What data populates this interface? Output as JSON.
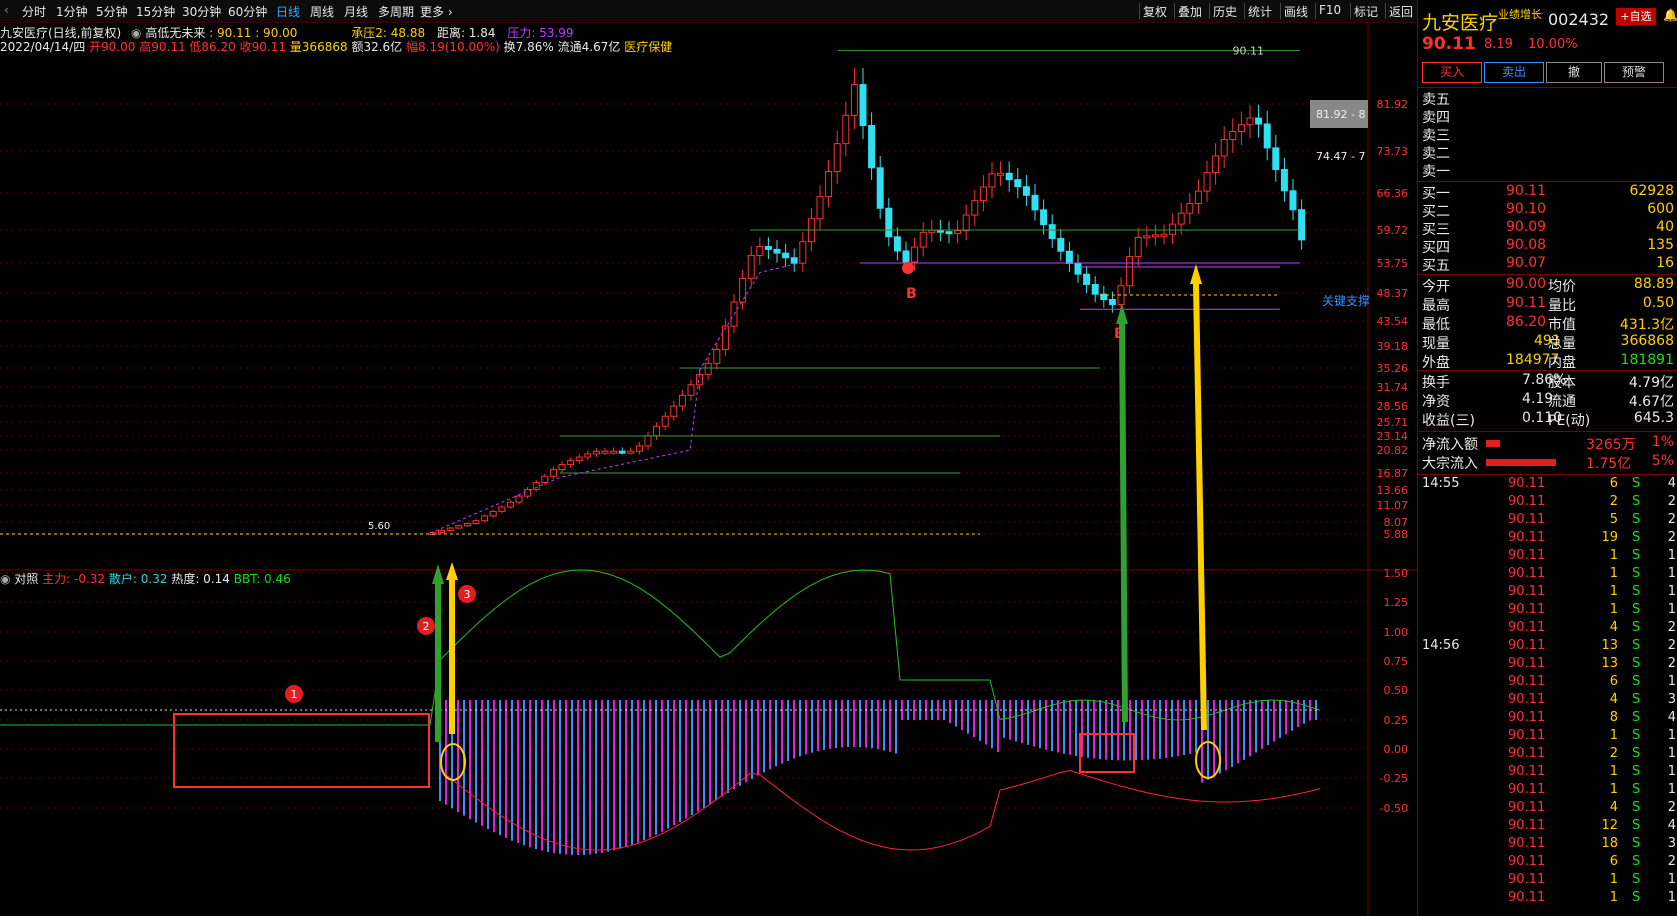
{
  "toolbar": {
    "periods": [
      "分时",
      "1分钟",
      "5分钟",
      "15分钟",
      "30分钟",
      "60分钟",
      "日线",
      "周线",
      "月线",
      "多周期",
      "更多"
    ],
    "active": "日线",
    "right_buttons": [
      "复权",
      "叠加",
      "历史",
      "统计",
      "画线",
      "F10",
      "标记",
      "返回"
    ]
  },
  "info": {
    "title": "九安医疗(日线,前复权)",
    "indicator": "高低无未来",
    "ind_value": ": 90.11 : 90.00",
    "chengya": "承压2: 48.88",
    "juli": "距离: 1.84",
    "yali": "压力: 53.99",
    "date": "2022/04/14/四",
    "open": "开90.00",
    "high": "高90.11",
    "low": "低86.20",
    "close": "收90.11",
    "vol": "量366868",
    "amount": "额32.6亿",
    "change": "幅8.19(10.00%)",
    "turnover": "换7.86%",
    "float": "流通4.67亿",
    "sector": "医疗保健"
  },
  "sub_info": {
    "label": "对照",
    "zhuli": "主力: -0.32",
    "sanhu": "散户: 0.32",
    "redu": "热度: 0.14",
    "bbt": "BBT: 0.46"
  },
  "main_axis": [
    "81.92",
    "73.73",
    "66.36",
    "59.72",
    "53.75",
    "48.37",
    "43.54",
    "39.18",
    "35.26",
    "31.74",
    "28.56",
    "25.71",
    "23.14",
    "20.82",
    "16.87",
    "13.66",
    "11.07",
    "8.07",
    "5.88"
  ],
  "sub_axis": [
    "1.50",
    "1.25",
    "1.00",
    "0.75",
    "0.50",
    "0.25",
    "0.00",
    "-0.25",
    "-0.50"
  ],
  "annotations": {
    "peak_price": "90.11",
    "range1": "81.92 - 8",
    "range2": "74.47 - 7",
    "support": "关键支撑",
    "low_label": "5.60",
    "b": "B",
    "markers": [
      "1",
      "2",
      "3"
    ]
  },
  "quote": {
    "name": "九安医疗",
    "tag": "业绩增长",
    "code": "002432",
    "watch_btn": "+自选",
    "price": "90.11",
    "chg": "8.19",
    "pct": "10.00%",
    "buttons": [
      "买入",
      "卖出",
      "撤",
      "预警"
    ],
    "sell_levels": [
      "卖五",
      "卖四",
      "卖三",
      "卖二",
      "卖一"
    ],
    "buy_levels": [
      {
        "label": "买一",
        "price": "90.11",
        "vol": "62928"
      },
      {
        "label": "买二",
        "price": "90.10",
        "vol": "600"
      },
      {
        "label": "买三",
        "price": "90.09",
        "vol": "40"
      },
      {
        "label": "买四",
        "price": "90.08",
        "vol": "135"
      },
      {
        "label": "买五",
        "price": "90.07",
        "vol": "16"
      }
    ],
    "stats": [
      [
        "今开",
        "90.00",
        "均价",
        "88.89"
      ],
      [
        "最高",
        "90.11",
        "量比",
        "0.50"
      ],
      [
        "最低",
        "86.20",
        "市值",
        "431.3亿"
      ],
      [
        "现量",
        "491",
        "总量",
        "366868"
      ],
      [
        "外盘",
        "184977",
        "内盘",
        "181891"
      ]
    ],
    "stats2": [
      [
        "换手",
        "7.86%",
        "股本",
        "4.79亿"
      ],
      [
        "净资",
        "4.19",
        "流通",
        "4.67亿"
      ],
      [
        "收益(三)",
        "0.110",
        "PE(动)",
        "645.3"
      ]
    ],
    "flow": [
      {
        "label": "净流入额",
        "value": "3265万",
        "pct": "1%",
        "bar": 0.1
      },
      {
        "label": "大宗流入",
        "value": "1.75亿",
        "pct": "5%",
        "bar": 0.5
      }
    ],
    "ticks": [
      {
        "time": "14:55",
        "price": "90.11",
        "vol": "6",
        "side": "S",
        "n": "4"
      },
      {
        "time": "",
        "price": "90.11",
        "vol": "2",
        "side": "S",
        "n": "2"
      },
      {
        "time": "",
        "price": "90.11",
        "vol": "5",
        "side": "S",
        "n": "2"
      },
      {
        "time": "",
        "price": "90.11",
        "vol": "19",
        "side": "S",
        "n": "2"
      },
      {
        "time": "",
        "price": "90.11",
        "vol": "1",
        "side": "S",
        "n": "1"
      },
      {
        "time": "",
        "price": "90.11",
        "vol": "1",
        "side": "S",
        "n": "1"
      },
      {
        "time": "",
        "price": "90.11",
        "vol": "1",
        "side": "S",
        "n": "1"
      },
      {
        "time": "",
        "price": "90.11",
        "vol": "1",
        "side": "S",
        "n": "1"
      },
      {
        "time": "",
        "price": "90.11",
        "vol": "4",
        "side": "S",
        "n": "2"
      },
      {
        "time": "14:56",
        "price": "90.11",
        "vol": "13",
        "side": "S",
        "n": "2"
      },
      {
        "time": "",
        "price": "90.11",
        "vol": "13",
        "side": "S",
        "n": "2"
      },
      {
        "time": "",
        "price": "90.11",
        "vol": "6",
        "side": "S",
        "n": "1"
      },
      {
        "time": "",
        "price": "90.11",
        "vol": "4",
        "side": "S",
        "n": "3"
      },
      {
        "time": "",
        "price": "90.11",
        "vol": "8",
        "side": "S",
        "n": "4"
      },
      {
        "time": "",
        "price": "90.11",
        "vol": "1",
        "side": "S",
        "n": "1"
      },
      {
        "time": "",
        "price": "90.11",
        "vol": "2",
        "side": "S",
        "n": "1"
      },
      {
        "time": "",
        "price": "90.11",
        "vol": "1",
        "side": "S",
        "n": "1"
      },
      {
        "time": "",
        "price": "90.11",
        "vol": "1",
        "side": "S",
        "n": "1"
      },
      {
        "time": "",
        "price": "90.11",
        "vol": "4",
        "side": "S",
        "n": "2"
      },
      {
        "time": "",
        "price": "90.11",
        "vol": "12",
        "side": "S",
        "n": "4"
      },
      {
        "time": "",
        "price": "90.11",
        "vol": "18",
        "side": "S",
        "n": "3"
      },
      {
        "time": "",
        "price": "90.11",
        "vol": "6",
        "side": "S",
        "n": "2"
      },
      {
        "time": "",
        "price": "90.11",
        "vol": "1",
        "side": "S",
        "n": "1"
      },
      {
        "time": "",
        "price": "90.11",
        "vol": "1",
        "side": "S",
        "n": "1"
      }
    ]
  },
  "colors": {
    "up": "#ff3030",
    "down": "#30e0f0",
    "ma": "#20c020",
    "accent": "#ffd000"
  }
}
